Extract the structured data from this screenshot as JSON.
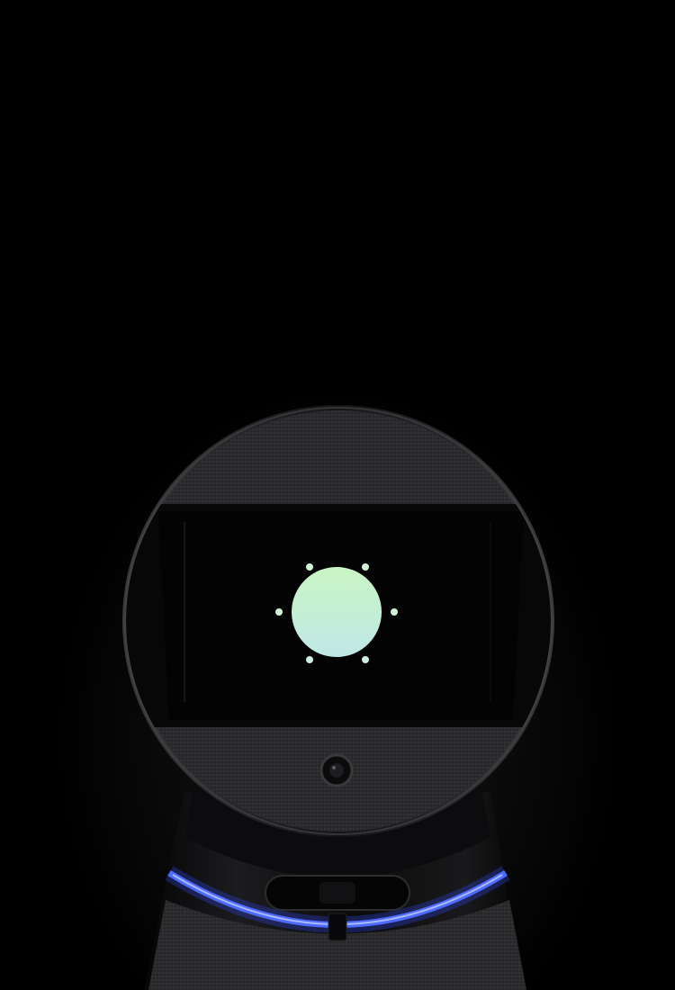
{
  "scene": {
    "subject": "robot-head-with-display",
    "display": {
      "icon": "sun-icon",
      "icon_colors": {
        "top": "#c9f5c4",
        "bottom": "#bfe8e6",
        "rays": "#d2f2d8"
      },
      "screen_color": "#030303"
    },
    "colors": {
      "background": "#000000",
      "fabric": "#2c2c2e",
      "body_plastic": "#0e0e10",
      "light_ring": "#3f5cff"
    }
  }
}
